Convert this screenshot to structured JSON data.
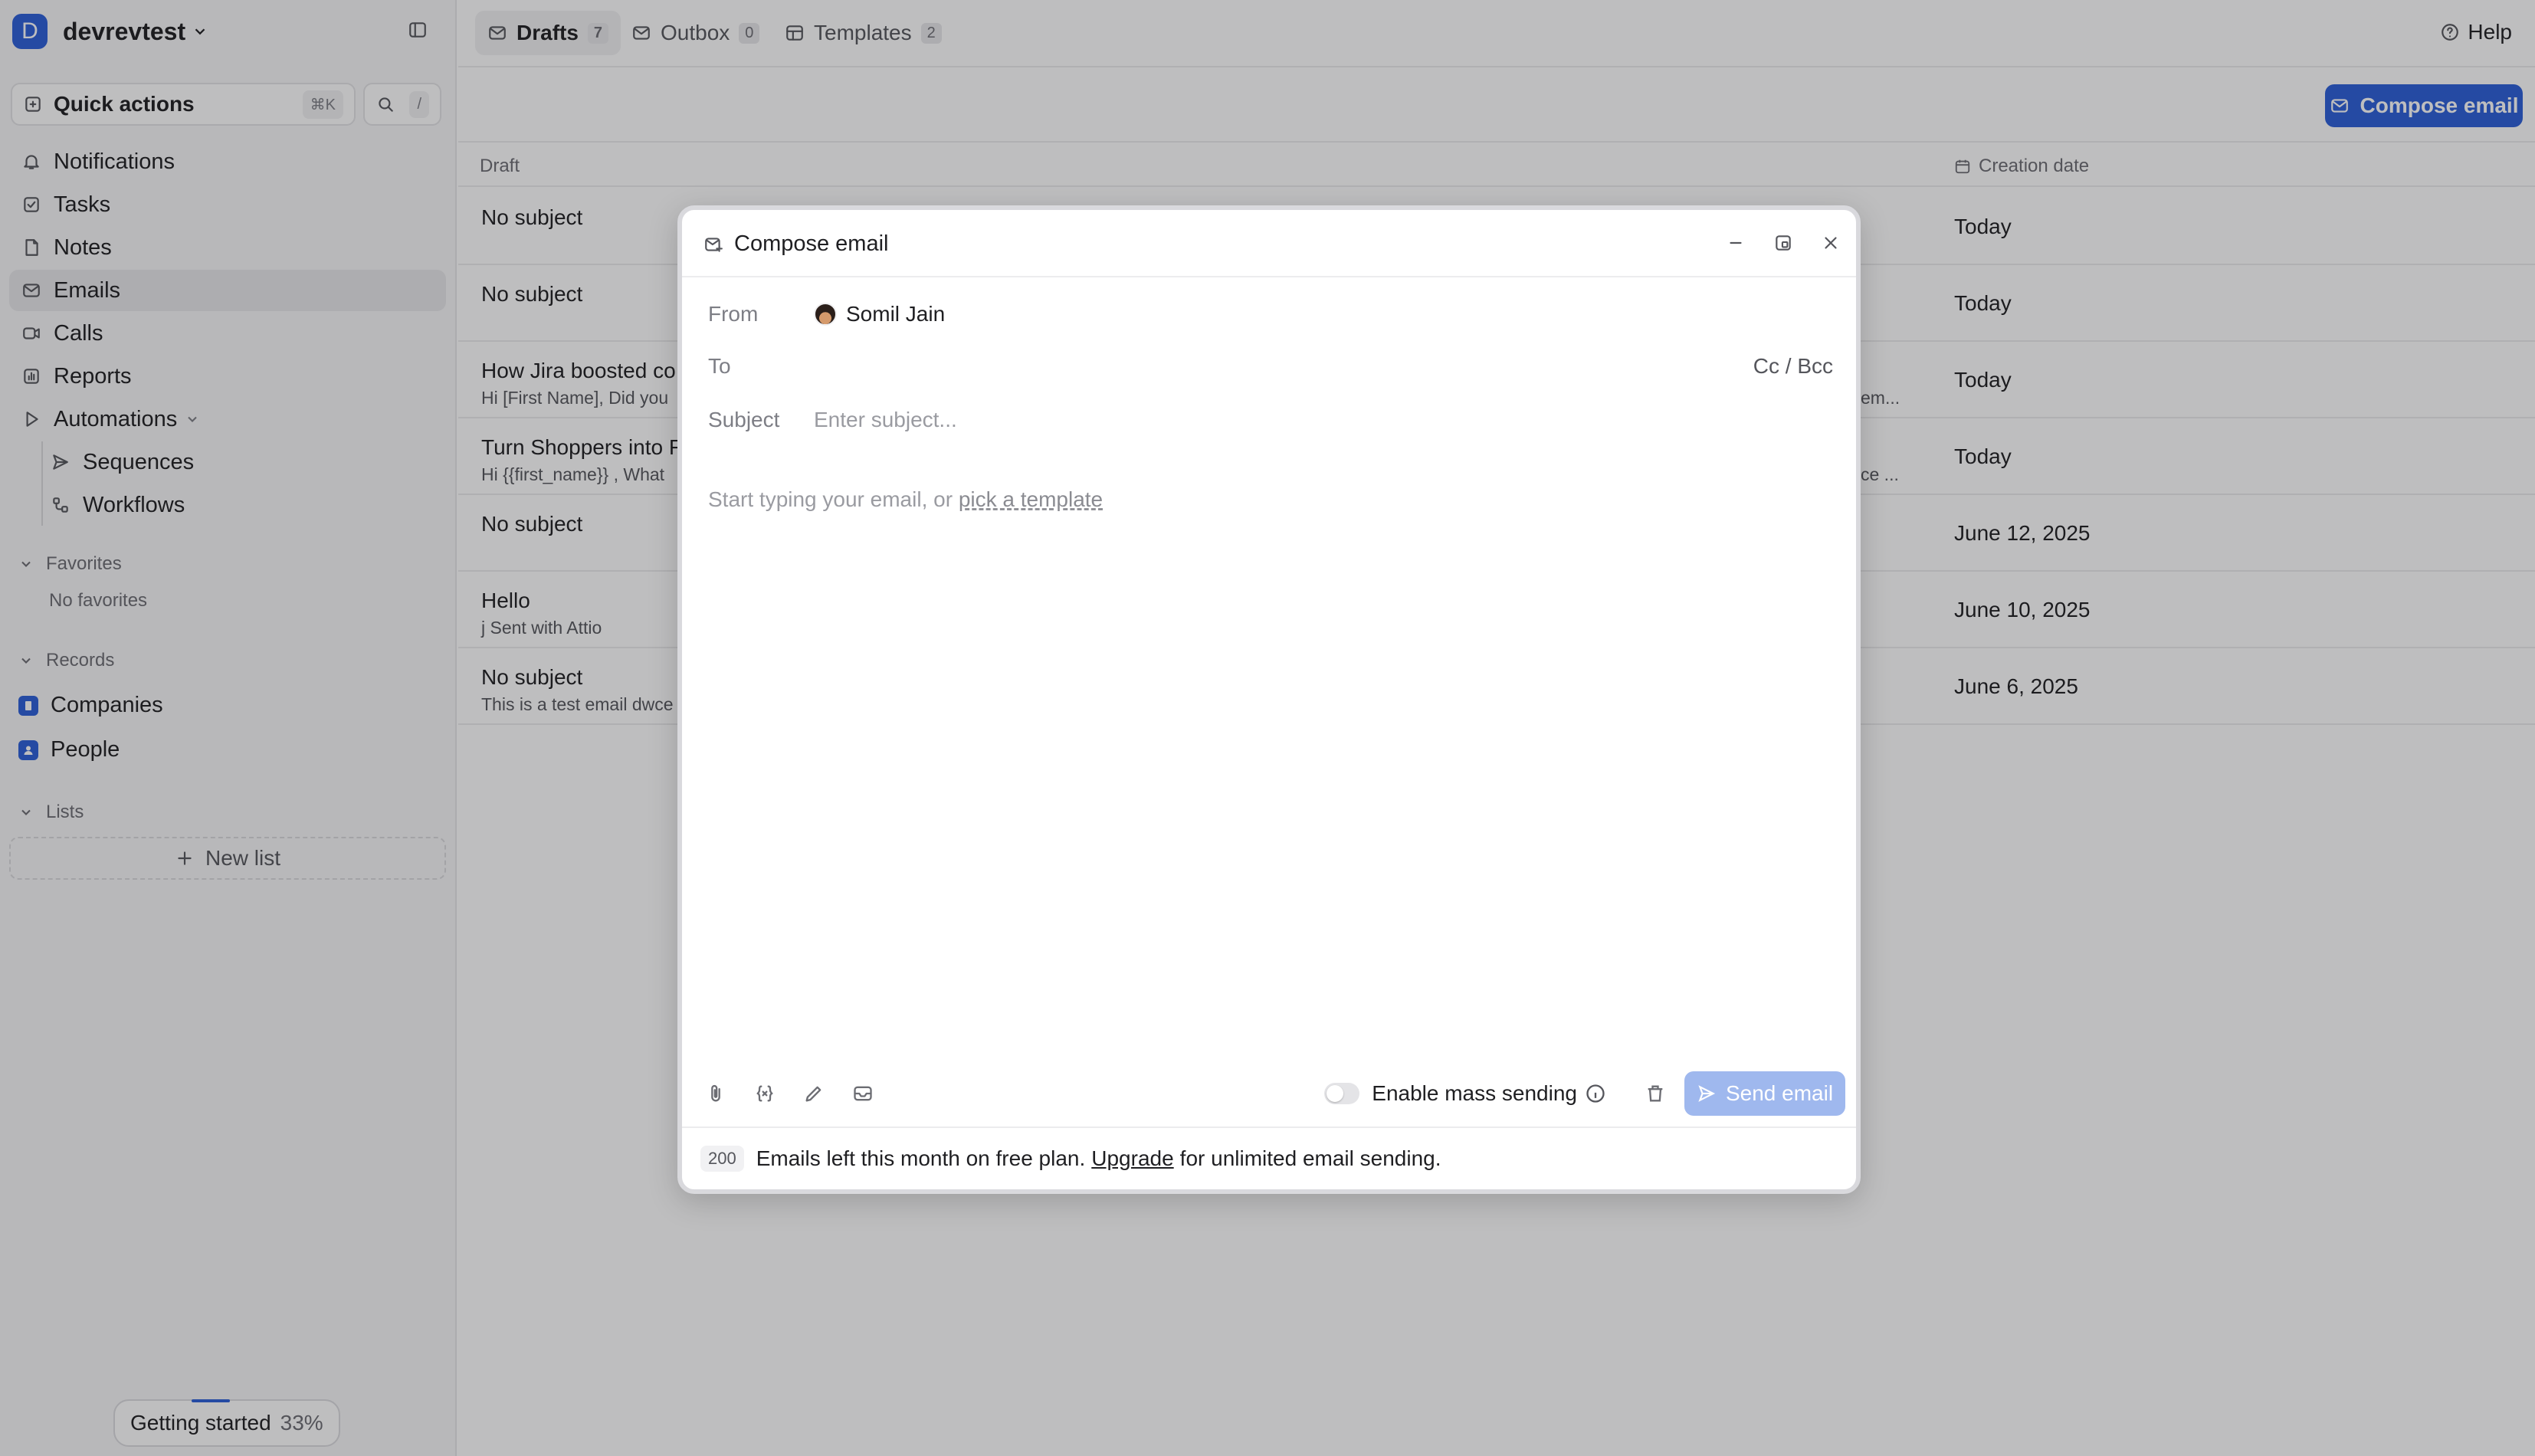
{
  "workspace": {
    "initial": "D",
    "name": "devrevtest"
  },
  "quick_actions": {
    "label": "Quick actions",
    "shortcut": "⌘K",
    "search_shortcut": "/"
  },
  "nav": {
    "notifications": "Notifications",
    "tasks": "Tasks",
    "notes": "Notes",
    "emails": "Emails",
    "calls": "Calls",
    "reports": "Reports",
    "automations": "Automations",
    "sequences": "Sequences",
    "workflows": "Workflows"
  },
  "favorites": {
    "title": "Favorites",
    "empty": "No favorites"
  },
  "records": {
    "title": "Records",
    "companies": "Companies",
    "people": "People"
  },
  "lists": {
    "title": "Lists",
    "new_list": "New list"
  },
  "getting_started": {
    "label": "Getting started",
    "percent": "33%",
    "progress": 0.33
  },
  "tabs": [
    {
      "label": "Drafts",
      "count": "7"
    },
    {
      "label": "Outbox",
      "count": "0"
    },
    {
      "label": "Templates",
      "count": "2"
    }
  ],
  "help": "Help",
  "compose_button": "Compose email",
  "table": {
    "col_draft": "Draft",
    "col_date": "Creation date",
    "rows": [
      {
        "title": "No subject",
        "preview": "",
        "tail": "",
        "date": "Today"
      },
      {
        "title": "No subject",
        "preview": "",
        "tail": "",
        "date": "Today"
      },
      {
        "title": "How Jira boosted co",
        "preview": "Hi [First Name], Did you",
        "tail": "em...",
        "date": "Today"
      },
      {
        "title": "Turn Shoppers into F",
        "preview": "Hi {{first_name}} , What",
        "tail": "ce ...",
        "date": "Today"
      },
      {
        "title": "No subject",
        "preview": "",
        "tail": "",
        "date": "June 12, 2025"
      },
      {
        "title": "Hello",
        "preview": "j Sent with Attio",
        "tail": "",
        "date": "June 10, 2025"
      },
      {
        "title": "No subject",
        "preview": "This is a test email dwce",
        "tail": "",
        "date": "June 6, 2025"
      }
    ]
  },
  "compose": {
    "title": "Compose email",
    "from_label": "From",
    "from_value": "Somil Jain",
    "to_label": "To",
    "cc_bcc": "Cc / Bcc",
    "subject_label": "Subject",
    "subject_placeholder": "Enter subject...",
    "body_prefix": "Start typing your email, or ",
    "body_link": "pick a template",
    "mass_sending": "Enable mass sending",
    "send": "Send email",
    "footer_count": "200",
    "footer_text": "Emails left this month on free plan.",
    "footer_upgrade": "Upgrade",
    "footer_suffix": "for unlimited email sending."
  }
}
